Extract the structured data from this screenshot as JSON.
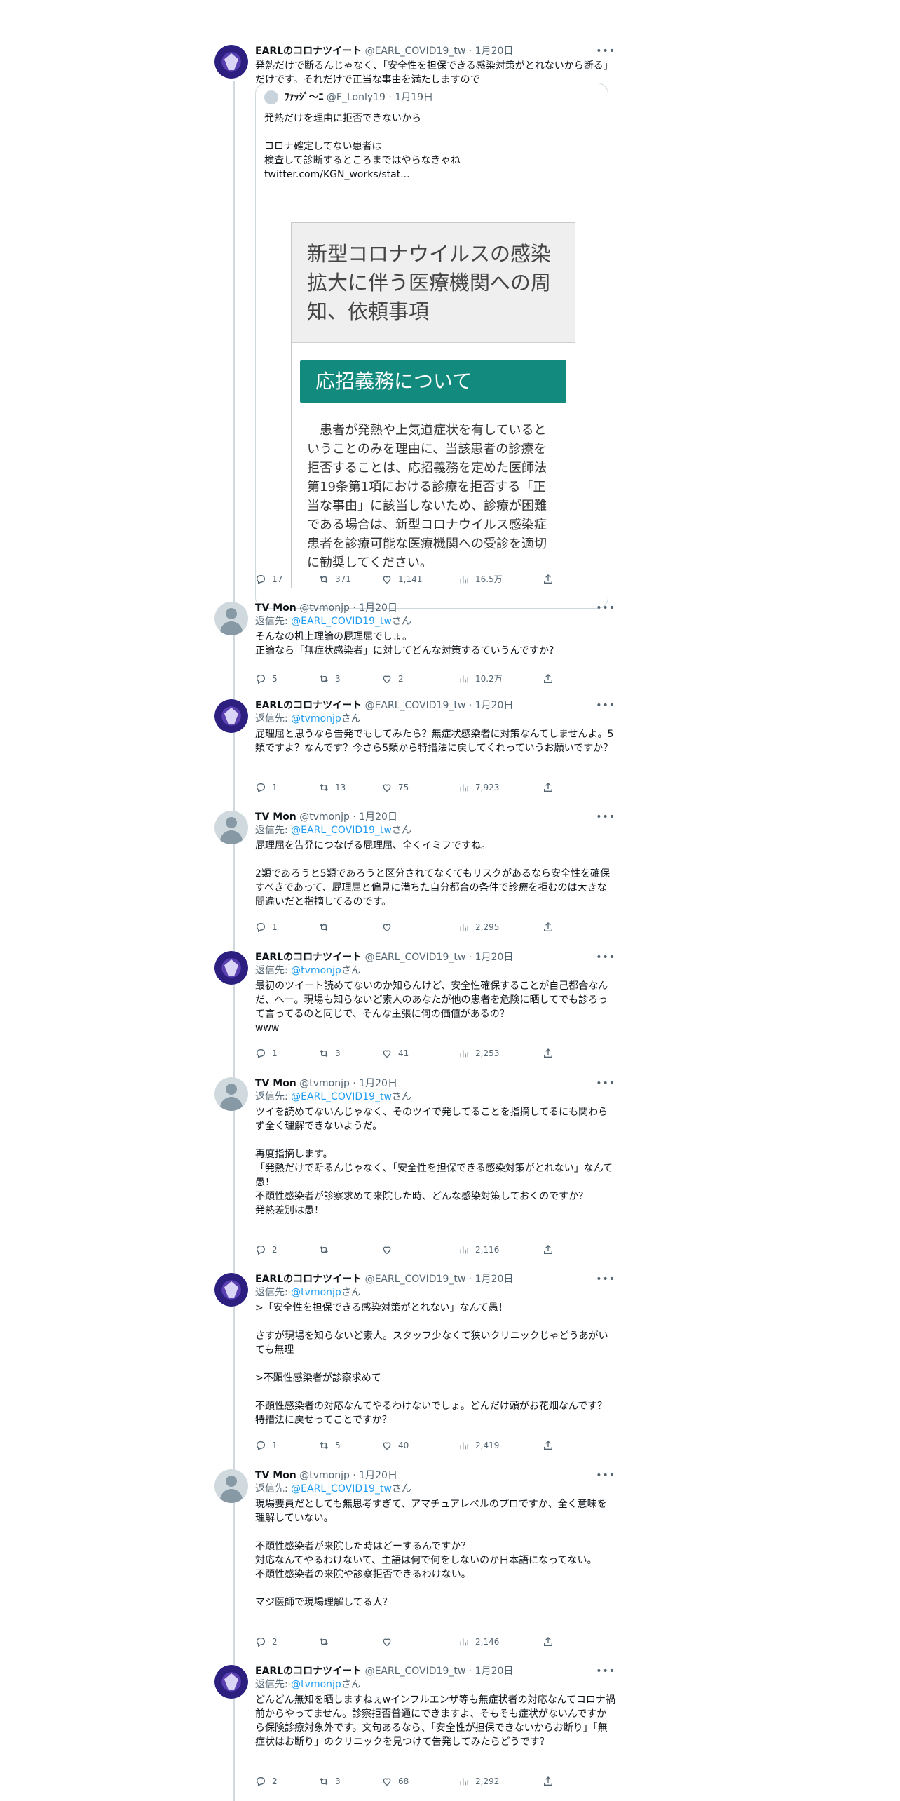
{
  "tweets": [
    {
      "avatar": "earl-avatar",
      "name": "EARLのコロナツイート",
      "handle": "@EARL_COVID19_tw",
      "date": "1月20日",
      "text": "発熱だけで断るんじゃなく、「安全性を担保できる感染対策がとれないから断る」だけです。それだけで正当な事由を満たしますので",
      "quote": {
        "name": "ﾌｧｯｼﾞ～ﾆ",
        "handle": "@F_Lonly19",
        "date": "1月19日",
        "text": "発熱だけを理由に拒否できないから\n\nコロナ確定してない患者は\n検査して診断するところまではやらなきゃね\ntwitter.com/KGN_works/stat...",
        "doc_title": "新型コロナウイルスの感染拡大に伴う医療機関への周知、依頼事項",
        "doc_banner": "応招義務について",
        "doc_body": "　患者が発熱や上気道症状を有しているということのみを理由に、当該患者の診療を拒否することは、応招義務を定めた医師法第19条第1項における診療を拒否する「正当な事由」に該当しないため、診療が困難である場合は、新型コロナウイルス感染症患者を診療可能な医療機関への受診を適切に勧奨してください。"
      },
      "replies": "17",
      "retweets": "371",
      "likes": "1,141",
      "views": "16.5万"
    },
    {
      "avatar": "tv-avatar",
      "name": "TV Mon",
      "handle": "@tvmonjp",
      "date": "1月20日",
      "reply_prefix": "返信先: ",
      "reply_mention": "@EARL_COVID19_tw",
      "reply_suffix": "さん",
      "text": "そんなの机上理論の屁理屈でしょ。\n正論なら「無症状感染者」に対してどんな対策するていうんですか？",
      "replies": "5",
      "retweets": "3",
      "likes": "2",
      "views": "10.2万"
    },
    {
      "avatar": "earl-avatar",
      "name": "EARLのコロナツイート",
      "handle": "@EARL_COVID19_tw",
      "date": "1月20日",
      "reply_prefix": "返信先: ",
      "reply_mention": "@tvmonjp",
      "reply_suffix": "さん",
      "text": "屁理屈と思うなら告発でもしてみたら？無症状感染者に対策なんてしませんよ。5類ですよ？なんです？今さら5類から特措法に戻してくれっていうお願いですか？",
      "replies": "1",
      "retweets": "13",
      "likes": "75",
      "views": "7,923"
    },
    {
      "avatar": "tv-avatar",
      "name": "TV Mon",
      "handle": "@tvmonjp",
      "date": "1月20日",
      "reply_prefix": "返信先: ",
      "reply_mention": "@EARL_COVID19_tw",
      "reply_suffix": "さん",
      "text": "屁理屈を告発につなげる屁理屈、全くイミフですね。\n\n2類であろうと5類であろうと区分されてなくてもリスクがあるなら安全性を確保すべきであって、屁理屈と偏見に満ちた自分都合の条件で診療を拒むのは大きな間違いだと指摘してるのです。",
      "replies": "1",
      "retweets": "",
      "likes": "",
      "views": "2,295"
    },
    {
      "avatar": "earl-avatar",
      "name": "EARLのコロナツイート",
      "handle": "@EARL_COVID19_tw",
      "date": "1月20日",
      "reply_prefix": "返信先: ",
      "reply_mention": "@tvmonjp",
      "reply_suffix": "さん",
      "text": "最初のツイート読めてないのか知らんけど、安全性確保することが自己都合なんだ、へー。現場も知らないど素人のあなたが他の患者を危険に晒してでも診ろって言ってるのと同じで、そんな主張に何の価値があるの？\nwww",
      "replies": "1",
      "retweets": "3",
      "likes": "41",
      "views": "2,253"
    },
    {
      "avatar": "tv-avatar",
      "name": "TV Mon",
      "handle": "@tvmonjp",
      "date": "1月20日",
      "reply_prefix": "返信先: ",
      "reply_mention": "@EARL_COVID19_tw",
      "reply_suffix": "さん",
      "text": "ツイを読めてないんじゃなく、そのツイで発してることを指摘してるにも関わらず全く理解できないようだ。\n\n再度指摘します。\n「発熱だけで断るんじゃなく、「安全性を担保できる感染対策がとれない」なんて愚！\n不顕性感染者が診察求めて来院した時、どんな感染対策しておくのですか？\n発熱差別は愚！",
      "replies": "2",
      "retweets": "",
      "likes": "",
      "views": "2,116"
    },
    {
      "avatar": "earl-avatar",
      "name": "EARLのコロナツイート",
      "handle": "@EARL_COVID19_tw",
      "date": "1月20日",
      "reply_prefix": "返信先: ",
      "reply_mention": "@tvmonjp",
      "reply_suffix": "さん",
      "text": ">「安全性を担保できる感染対策がとれない」なんて愚！\n\nさすが現場を知らないど素人。スタッフ少なくて狭いクリニックじゃどうあがいても無理\n\n>不顕性感染者が診察求めて\n\n不顕性感染者の対応なんてやるわけないでしょ。どんだけ頭がお花畑なんです？特措法に戻せってことですか？",
      "replies": "1",
      "retweets": "5",
      "likes": "40",
      "views": "2,419"
    },
    {
      "avatar": "tv-avatar",
      "name": "TV Mon",
      "handle": "@tvmonjp",
      "date": "1月20日",
      "reply_prefix": "返信先: ",
      "reply_mention": "@EARL_COVID19_tw",
      "reply_suffix": "さん",
      "text": "現場要員だとしても無思考すぎて、アマチュアレベルのプロですか、全く意味を理解していない。\n\n不顕性感染者が来院した時はどーするんですか？\n対応なんてやるわけないて、主語は何で何をしないのか日本語になってない。\n不顕性感染者の来院や診察拒否できるわけない。\n\nマジ医師で現場理解してる人？",
      "replies": "2",
      "retweets": "",
      "likes": "",
      "views": "2,146"
    },
    {
      "avatar": "earl-avatar",
      "name": "EARLのコロナツイート",
      "handle": "@EARL_COVID19_tw",
      "date": "1月20日",
      "reply_prefix": "返信先: ",
      "reply_mention": "@tvmonjp",
      "reply_suffix": "さん",
      "text": "どんどん無知を晒しますねぇwインフルエンザ等も無症状者の対応なんてコロナ禍前からやってません。診察拒否普通にできますよ、そもそも症状がないんですから保険診療対象外です。文句あるなら、「安全性が担保できないからお断り」「無症状はお断り」のクリニックを見つけて告発してみたらどうです？",
      "replies": "2",
      "retweets": "3",
      "likes": "68",
      "views": "2,292"
    }
  ]
}
